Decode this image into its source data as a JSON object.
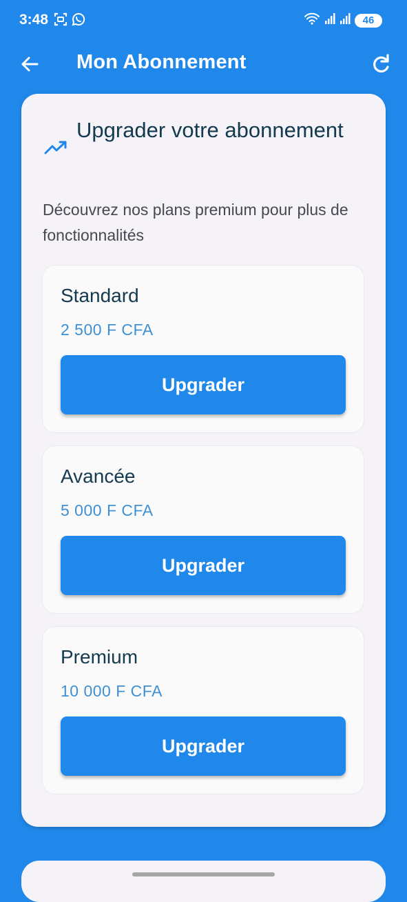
{
  "status_bar": {
    "time": "3:48",
    "battery": "46",
    "icons": [
      "screenshot-icon",
      "whatsapp-icon",
      "wifi-icon",
      "signal-icon",
      "signal-icon",
      "battery-icon"
    ]
  },
  "app_bar": {
    "title": "Mon Abonnement",
    "back_icon": "arrow-left-icon",
    "refresh_icon": "refresh-icon"
  },
  "upgrade_section": {
    "icon": "trending-up-icon",
    "title": "Upgrader votre abonnement",
    "subtitle": "Découvrez nos plans premium pour plus de fonctionnalités",
    "plans": [
      {
        "name": "Standard",
        "price": "2 500 F CFA",
        "button": "Upgrader"
      },
      {
        "name": "Avancée",
        "price": "5 000 F CFA",
        "button": "Upgrader"
      },
      {
        "name": "Premium",
        "price": "10 000 F CFA",
        "button": "Upgrader"
      }
    ]
  },
  "colors": {
    "primary": "#2088ea",
    "card_background": "#f5f2f8",
    "plan_background": "#fafafa",
    "title_text": "#133a4f",
    "price_text": "#3f8fd1"
  }
}
